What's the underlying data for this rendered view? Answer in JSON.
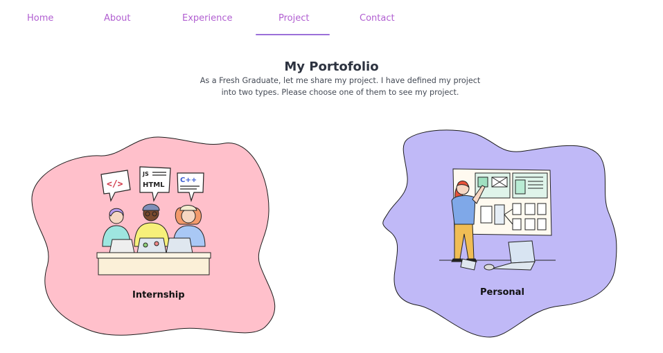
{
  "nav": {
    "items": [
      {
        "label": "Home",
        "active": false
      },
      {
        "label": "About",
        "active": false
      },
      {
        "label": "Experience",
        "active": false
      },
      {
        "label": "Project",
        "active": true
      },
      {
        "label": "Contact",
        "active": false
      }
    ]
  },
  "header": {
    "title": "My Portofolio",
    "subtitle": "As a Fresh Graduate, let me share my project. I have defined my project into two types. Please choose one of them to see my project."
  },
  "cards": [
    {
      "label": "Internship",
      "icon": "team-coding-illustration",
      "bubbles": [
        "</>",
        "JS HTML",
        "C++"
      ]
    },
    {
      "label": "Personal",
      "icon": "wireframe-planning-illustration"
    }
  ],
  "colors": {
    "nav_text": "#b15fd1",
    "underline": "#9b6fd9",
    "internship_blob": "#ffc0cb",
    "personal_blob": "#c0b9f7"
  }
}
